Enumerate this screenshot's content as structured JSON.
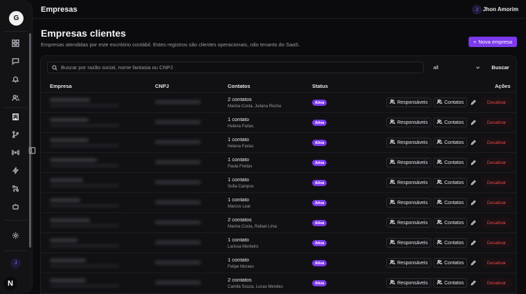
{
  "sidebar": {
    "logo_letter": "G",
    "icons": [
      "grid-icon",
      "chat-icon",
      "bell-icon",
      "users-icon",
      "building-icon",
      "branch-icon",
      "broadcast-icon",
      "bolt-icon",
      "route-icon",
      "bot-icon",
      "gear-icon"
    ],
    "user_initial": "J",
    "n_badge": "N"
  },
  "header": {
    "title": "Empresas",
    "user_initial": "J",
    "user_name": "Jhon Amorim"
  },
  "page": {
    "title": "Empresas clientes",
    "subtitle": "Empresas atendidas por este escritório contábil. Estes registros são clientes operacionais, não tenants do SaaS.",
    "new_button": "Nova empresa"
  },
  "filters": {
    "search_placeholder": "Buscar por razão social, nome fantasia ou CNPJ",
    "select_value": "all",
    "search_button": "Buscar"
  },
  "table": {
    "headers": [
      "Empresa",
      "CNPJ",
      "Contatos",
      "Status",
      "Ações"
    ],
    "rows": [
      {
        "contacts_count": "2 contatos",
        "contacts_names": "Marina Costa, Juliana Rocha",
        "status": "Ativa"
      },
      {
        "contacts_count": "1 contato",
        "contacts_names": "Helena Farias",
        "status": "Ativa"
      },
      {
        "contacts_count": "1 contato",
        "contacts_names": "Helena Farias",
        "status": "Ativa"
      },
      {
        "contacts_count": "1 contato",
        "contacts_names": "Paula Freitas",
        "status": "Ativa"
      },
      {
        "contacts_count": "1 contato",
        "contacts_names": "Sofia Campos",
        "status": "Ativa"
      },
      {
        "contacts_count": "1 contato",
        "contacts_names": "Marcos Leal",
        "status": "Ativa"
      },
      {
        "contacts_count": "2 contatos",
        "contacts_names": "Marina Costa, Rafael Lima",
        "status": "Ativa"
      },
      {
        "contacts_count": "1 contato",
        "contacts_names": "Larissa Monteiro",
        "status": "Ativa"
      },
      {
        "contacts_count": "1 contato",
        "contacts_names": "Felipe Moraes",
        "status": "Ativa"
      },
      {
        "contacts_count": "2 contatos",
        "contacts_names": "Camila Souza, Lucas Mendes",
        "status": "Ativa"
      }
    ],
    "actions": {
      "responsaveis": "Responsáveis",
      "contatos": "Contatos",
      "desativar": "Desativar"
    }
  },
  "colors": {
    "accent": "#7c3aed",
    "danger": "#ef4444",
    "background": "#0b0b0d"
  }
}
